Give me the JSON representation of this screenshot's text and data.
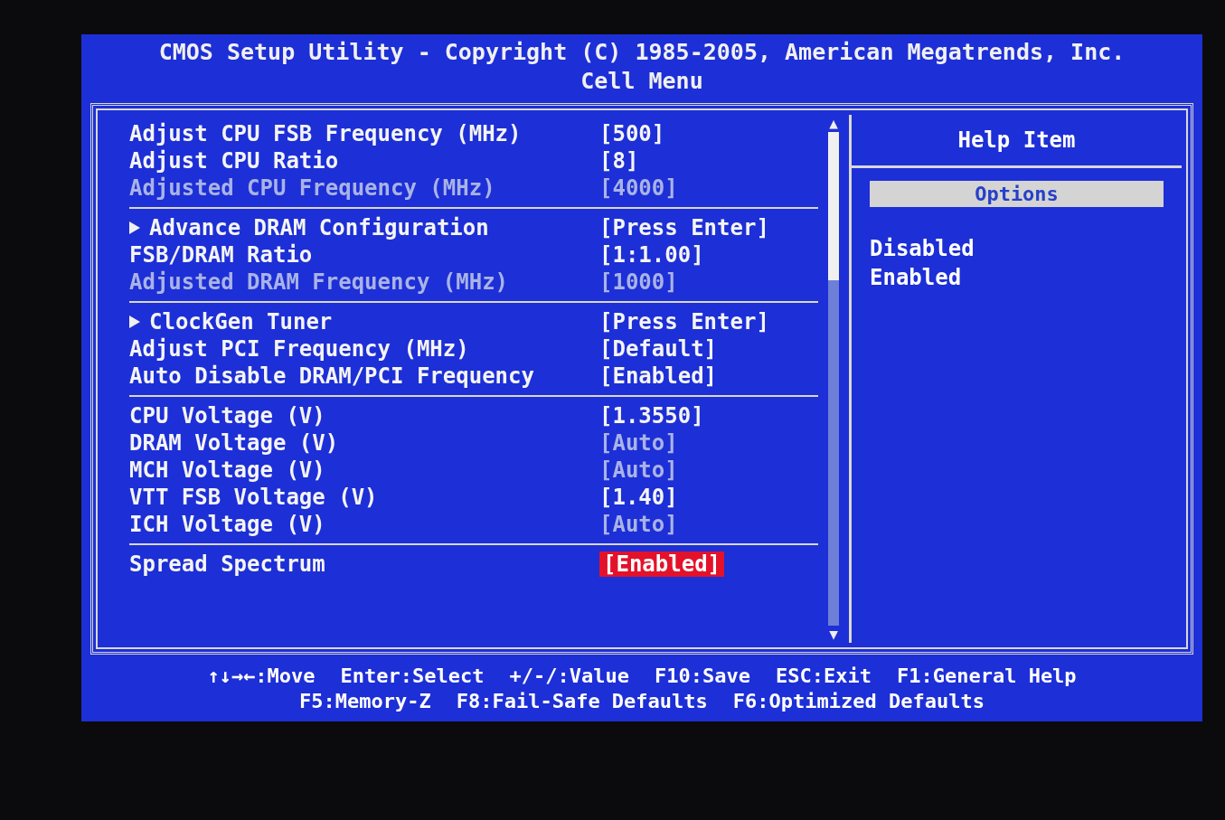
{
  "header": {
    "title": "CMOS Setup Utility - Copyright (C) 1985-2005, American Megatrends, Inc.",
    "subtitle": "Cell Menu"
  },
  "groups": [
    {
      "items": [
        {
          "kind": "setting",
          "label": "Adjust CPU FSB Frequency (MHz)",
          "value": "[500]",
          "label_dimmed": false,
          "value_dimmed": false,
          "selected": false
        },
        {
          "kind": "setting",
          "label": "Adjust CPU Ratio",
          "value": "[8]",
          "label_dimmed": false,
          "value_dimmed": false,
          "selected": false
        },
        {
          "kind": "setting",
          "label": "Adjusted CPU Frequency (MHz)",
          "value": "[4000]",
          "label_dimmed": true,
          "value_dimmed": true,
          "selected": false
        }
      ]
    },
    {
      "items": [
        {
          "kind": "submenu",
          "label": "Advance DRAM Configuration",
          "value": "[Press Enter]",
          "label_dimmed": false,
          "value_dimmed": false,
          "selected": false
        },
        {
          "kind": "setting",
          "label": "FSB/DRAM Ratio",
          "value": "[1:1.00]",
          "label_dimmed": false,
          "value_dimmed": false,
          "selected": false
        },
        {
          "kind": "setting",
          "label": "Adjusted DRAM Frequency (MHz)",
          "value": "[1000]",
          "label_dimmed": true,
          "value_dimmed": true,
          "selected": false
        }
      ]
    },
    {
      "items": [
        {
          "kind": "submenu",
          "label": "ClockGen Tuner",
          "value": "[Press Enter]",
          "label_dimmed": false,
          "value_dimmed": false,
          "selected": false
        },
        {
          "kind": "setting",
          "label": "Adjust PCI Frequency (MHz)",
          "value": "[Default]",
          "label_dimmed": false,
          "value_dimmed": false,
          "selected": false
        },
        {
          "kind": "setting",
          "label": "Auto Disable DRAM/PCI Frequency",
          "value": "[Enabled]",
          "label_dimmed": false,
          "value_dimmed": false,
          "selected": false
        }
      ]
    },
    {
      "items": [
        {
          "kind": "setting",
          "label": "CPU Voltage (V)",
          "value": "[1.3550]",
          "label_dimmed": false,
          "value_dimmed": false,
          "selected": false
        },
        {
          "kind": "setting",
          "label": "DRAM Voltage (V)",
          "value": "[Auto]",
          "label_dimmed": false,
          "value_dimmed": true,
          "selected": false
        },
        {
          "kind": "setting",
          "label": "MCH Voltage (V)",
          "value": "[Auto]",
          "label_dimmed": false,
          "value_dimmed": true,
          "selected": false
        },
        {
          "kind": "setting",
          "label": "VTT FSB Voltage (V)",
          "value": "[1.40]",
          "label_dimmed": false,
          "value_dimmed": false,
          "selected": false
        },
        {
          "kind": "setting",
          "label": "ICH Voltage (V)",
          "value": "[Auto]",
          "label_dimmed": false,
          "value_dimmed": true,
          "selected": false
        }
      ]
    },
    {
      "items": [
        {
          "kind": "setting",
          "label": "Spread Spectrum",
          "value": "[Enabled]",
          "label_dimmed": false,
          "value_dimmed": false,
          "selected": true
        }
      ]
    }
  ],
  "scroll_up": "▲",
  "scroll_down": "▼",
  "help": {
    "title": "Help Item",
    "section": "Options",
    "lines": [
      "Disabled",
      "Enabled"
    ]
  },
  "key_rows": [
    [
      "↑↓→←:Move",
      "Enter:Select",
      "+/-/:Value",
      "F10:Save",
      "ESC:Exit",
      "F1:General Help"
    ],
    [
      "F5:Memory-Z",
      "F8:Fail-Safe Defaults",
      "F6:Optimized Defaults"
    ]
  ]
}
